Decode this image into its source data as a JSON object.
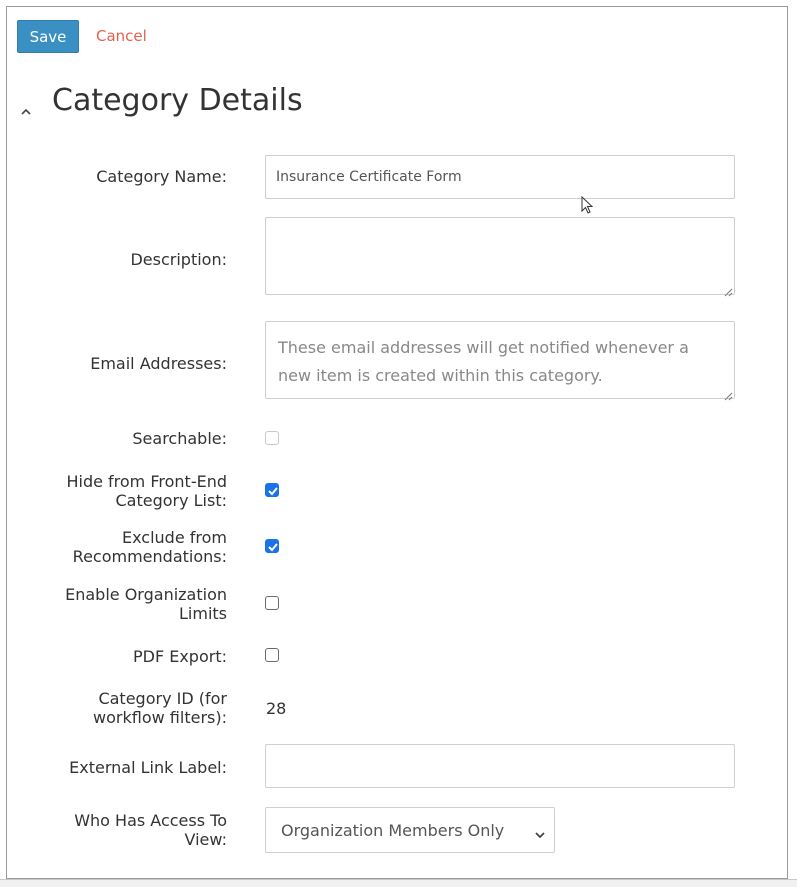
{
  "toolbar": {
    "save_label": "Save",
    "cancel_label": "Cancel"
  },
  "section": {
    "title": "Category Details",
    "collapse_icon": "chevron-up-icon"
  },
  "fields": {
    "category_name": {
      "label": "Category Name:",
      "value": "Insurance Certificate Form"
    },
    "description": {
      "label": "Description:",
      "value": ""
    },
    "email_addresses": {
      "label": "Email Addresses:",
      "placeholder": "These email addresses will get notified whenever a new item is created within this category."
    },
    "searchable": {
      "label": "Searchable:",
      "checked": false,
      "disabled": true
    },
    "hide_from_list": {
      "label_line1": "Hide from Front-End",
      "label_line2": "Category List:",
      "checked": true
    },
    "exclude_recommendations": {
      "label_line1": "Exclude from",
      "label_line2": "Recommendations:",
      "checked": true
    },
    "enable_org_limits": {
      "label_line1": "Enable Organization",
      "label_line2": "Limits",
      "checked": false
    },
    "pdf_export": {
      "label": "PDF Export:",
      "checked": false
    },
    "category_id": {
      "label_line1": "Category ID (for",
      "label_line2": "workflow filters):",
      "value": "28"
    },
    "external_link_label": {
      "label": "External Link Label:",
      "value": ""
    },
    "access": {
      "label_line1": "Who Has Access To",
      "label_line2": "View:",
      "selected": "Organization Members Only"
    }
  },
  "colors": {
    "primary": "#3a8fc3",
    "cancel": "#e4624f",
    "checkbox_checked": "#1a73e8"
  }
}
